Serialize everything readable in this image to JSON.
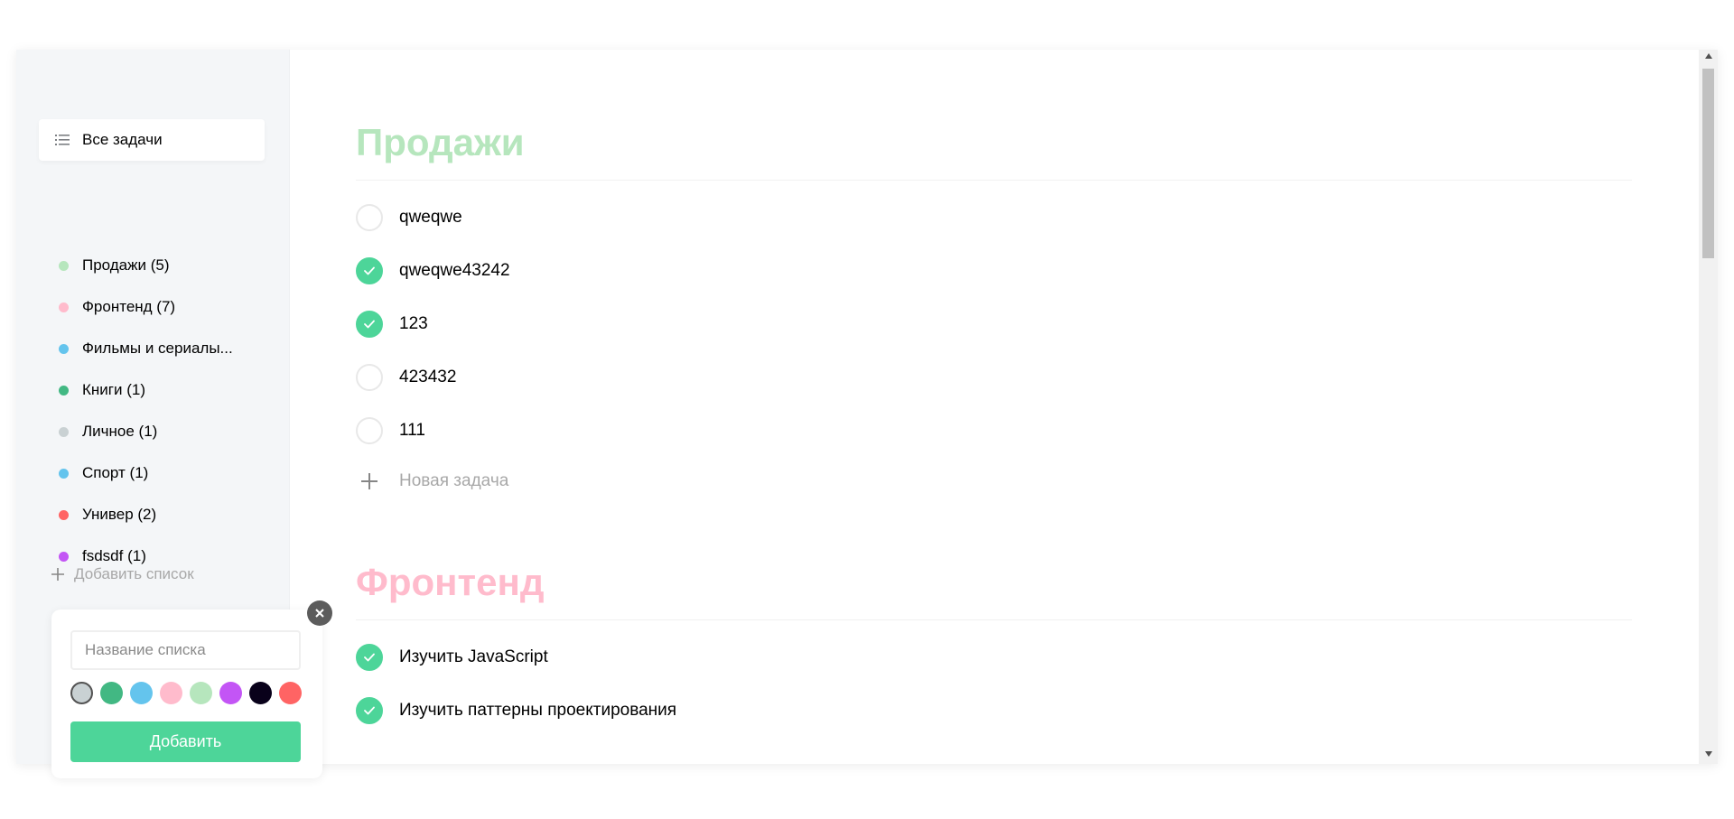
{
  "sidebar": {
    "all_tasks_label": "Все задачи",
    "lists": [
      {
        "label": "Продажи (5)",
        "color": "#b6e6bd"
      },
      {
        "label": "Фронтенд (7)",
        "color": "#ffbbcc"
      },
      {
        "label": "Фильмы и сериалы...",
        "color": "#64c4ed"
      },
      {
        "label": "Книги (1)",
        "color": "#42b883"
      },
      {
        "label": "Личное (1)",
        "color": "#c9d1d3"
      },
      {
        "label": "Спорт (1)",
        "color": "#64c4ed"
      },
      {
        "label": "Универ (2)",
        "color": "#ff6464"
      },
      {
        "label": "fsdsdf (1)",
        "color": "#c355f5"
      }
    ],
    "add_list_label": "Добавить список"
  },
  "sections": [
    {
      "title": "Продажи",
      "color": "#b6e6bd",
      "tasks": [
        {
          "text": "qweqwe",
          "done": false
        },
        {
          "text": "qweqwe43242",
          "done": true
        },
        {
          "text": "123",
          "done": true
        },
        {
          "text": "423432",
          "done": false
        },
        {
          "text": "111",
          "done": false
        }
      ],
      "new_task_label": "Новая задача"
    },
    {
      "title": "Фронтенд",
      "color": "#ffbbcc",
      "tasks": [
        {
          "text": "Изучить JavaScript",
          "done": true
        },
        {
          "text": "Изучить паттерны проектирования",
          "done": true
        }
      ]
    }
  ],
  "popup": {
    "input_placeholder": "Название списка",
    "input_value": "",
    "colors": [
      {
        "color": "#c9d1d3",
        "selected": true
      },
      {
        "color": "#42b883",
        "selected": false
      },
      {
        "color": "#64c4ed",
        "selected": false
      },
      {
        "color": "#ffbbcc",
        "selected": false
      },
      {
        "color": "#b6e6bd",
        "selected": false
      },
      {
        "color": "#c355f5",
        "selected": false
      },
      {
        "color": "#09011a",
        "selected": false
      },
      {
        "color": "#ff6464",
        "selected": false
      }
    ],
    "add_button_label": "Добавить"
  },
  "accent_color": "#4dd599"
}
